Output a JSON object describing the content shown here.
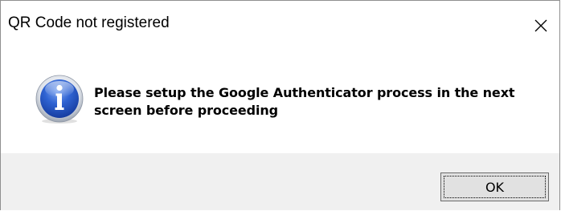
{
  "dialog": {
    "title": "QR Code not registered",
    "message": "Please setup the Google Authenticator process in the next screen before proceeding",
    "icon": "info-icon",
    "ok_label": "OK",
    "close_icon": "close-icon"
  },
  "colors": {
    "footer_background": "#f0f0f0",
    "button_background": "#e1e1e1",
    "icon_blue": "#1f4fb8"
  }
}
